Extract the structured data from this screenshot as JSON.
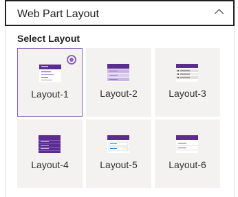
{
  "header": {
    "title": "Web Part Layout",
    "chevron_icon": "chevron-up-icon"
  },
  "select_layout_label": "Select Layout",
  "accent_color": "#8764b8",
  "layouts": [
    {
      "label": "Layout-1",
      "selected": true
    },
    {
      "label": "Layout-2",
      "selected": false
    },
    {
      "label": "Layout-3",
      "selected": false
    },
    {
      "label": "Layout-4",
      "selected": false
    },
    {
      "label": "Layout-5",
      "selected": false
    },
    {
      "label": "Layout-6",
      "selected": false
    }
  ]
}
